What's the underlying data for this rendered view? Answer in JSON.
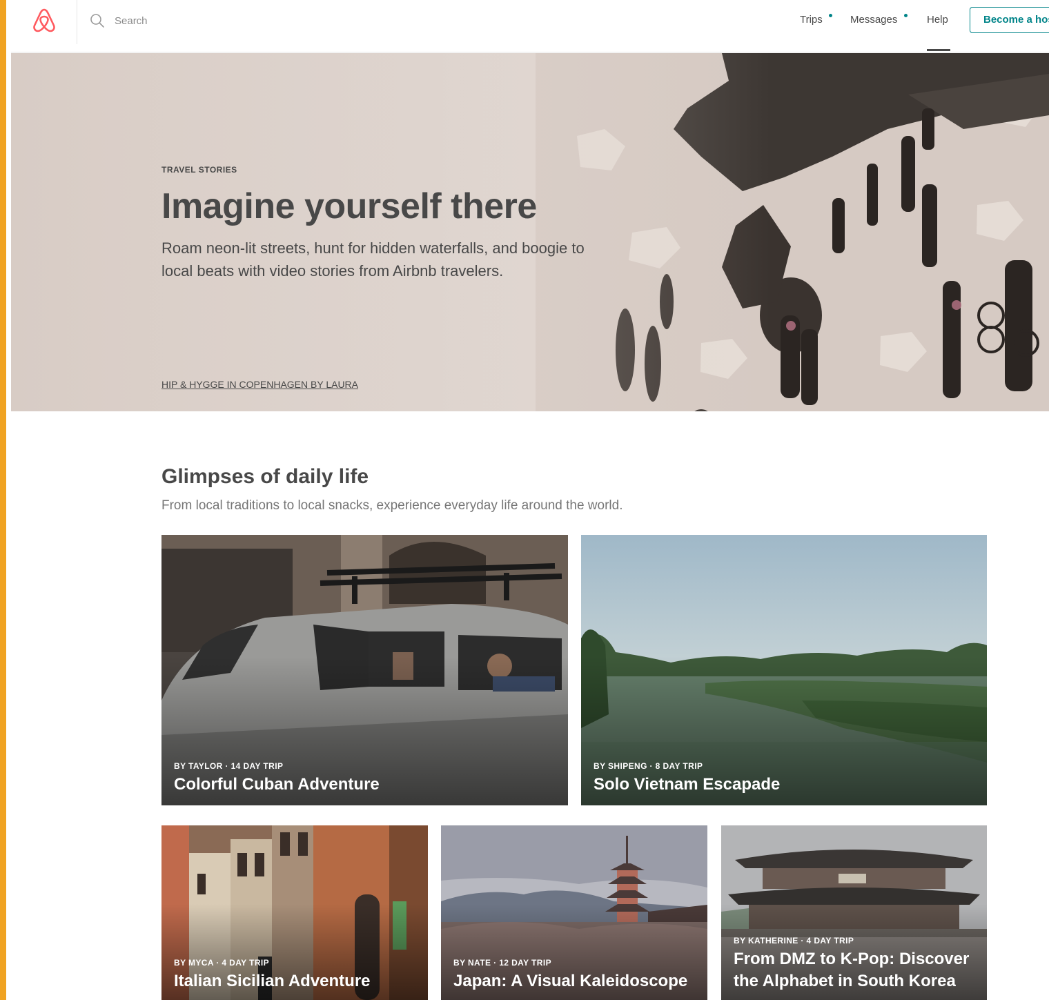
{
  "header": {
    "search_placeholder": "Search",
    "nav": {
      "trips": "Trips",
      "messages": "Messages",
      "help": "Help",
      "become_host": "Become a host"
    },
    "accent_color": "#008489",
    "brand_color": "#FF5A5F"
  },
  "hero": {
    "eyebrow": "TRAVEL STORIES",
    "title": "Imagine yourself there",
    "subtitle": "Roam neon-lit streets, hunt for hidden waterfalls, and boogie to local beats with video stories from Airbnb travelers.",
    "story_link": "HIP & HYGGE IN COPENHAGEN BY LAURA"
  },
  "section": {
    "title": "Glimpses of daily life",
    "subtitle": "From local traditions to local snacks, experience everyday life around the world."
  },
  "cards": [
    {
      "meta": "BY TAYLOR · 14 DAY TRIP",
      "title": "Colorful Cuban Adventure"
    },
    {
      "meta": "BY SHIPENG · 8 DAY TRIP",
      "title": "Solo Vietnam Escapade"
    },
    {
      "meta": "BY MYCA · 4 DAY TRIP",
      "title": "Italian Sicilian Adventure"
    },
    {
      "meta": "BY NATE · 12 DAY TRIP",
      "title": "Japan: A Visual Kaleidoscope"
    },
    {
      "meta": "BY KATHERINE · 4 DAY TRIP",
      "title": "From DMZ to K-Pop: Discover the Alphabet in South Korea"
    }
  ]
}
